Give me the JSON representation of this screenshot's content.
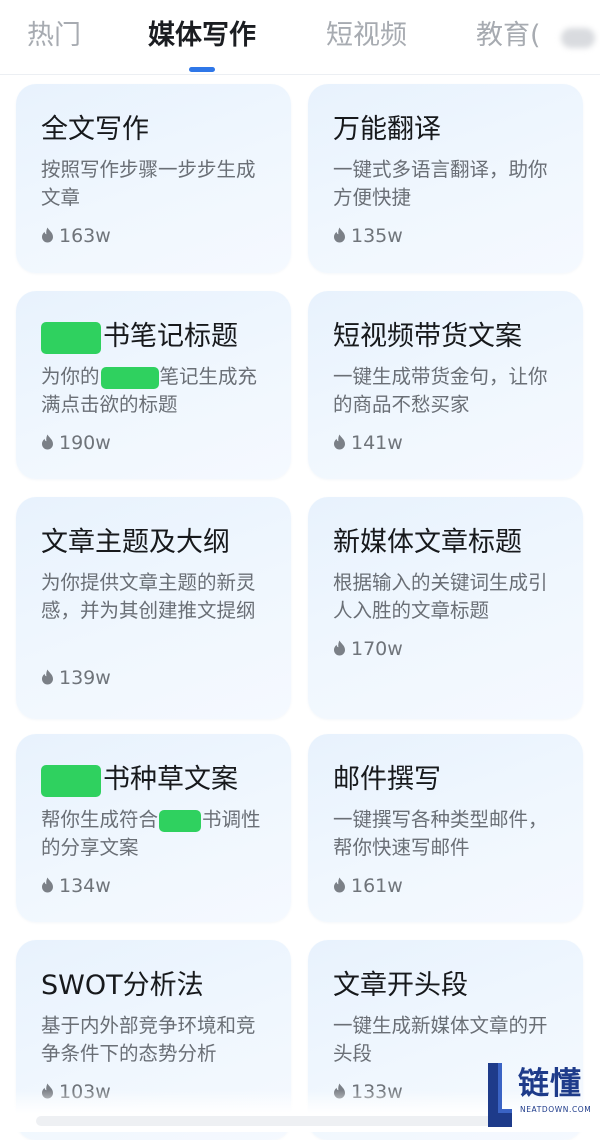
{
  "tabs": [
    {
      "label": "热门",
      "active": false
    },
    {
      "label": "媒体写作",
      "active": true
    },
    {
      "label": "短视频",
      "active": false
    },
    {
      "label": "教育(",
      "active": false
    }
  ],
  "cards": [
    {
      "title": "全文写作",
      "desc": "按照写作步骤一步步生成文章",
      "count": "163w"
    },
    {
      "title": "万能翻译",
      "desc": "一键式多语言翻译，助你方便快捷",
      "count": "135w"
    },
    {
      "title_visible": "书笔记标题",
      "desc_part1": "为你的",
      "desc_part2": "笔记生成充满点击欲的标题",
      "count": "190w",
      "redacted": true
    },
    {
      "title": "短视频带货文案",
      "desc": "一键生成带货金句，让你的商品不愁买家",
      "count": "141w"
    },
    {
      "title": "文章主题及大纲",
      "desc": "为你提供文章主题的新灵感，并为其创建推文提纲",
      "count": "139w"
    },
    {
      "title": "新媒体文章标题",
      "desc": "根据输入的关键词生成引人入胜的文章标题",
      "count": "170w"
    },
    {
      "title_visible": "书种草文案",
      "desc_part1": "帮你生成符合",
      "desc_part2": "书调性的分享文案",
      "count": "134w",
      "redacted": true
    },
    {
      "title": "邮件撰写",
      "desc": "一键撰写各种类型邮件，帮你快速写邮件",
      "count": "161w"
    },
    {
      "title": "SWOT分析法",
      "desc": "基于内外部竞争环境和竞争条件下的态势分析",
      "count": "103w"
    },
    {
      "title": "文章开头段",
      "desc": "一键生成新媒体文章的开头段",
      "count": "133w"
    }
  ],
  "icons": {
    "count_icon": "flame-icon"
  },
  "colors": {
    "accent": "#2f77e8",
    "card_bg": "#eaf3fe",
    "redaction": "#2fd15f",
    "watermark": "#1e3b8a"
  },
  "watermark": {
    "text": "链懂",
    "subtext": "NEATDOWN.COM"
  }
}
